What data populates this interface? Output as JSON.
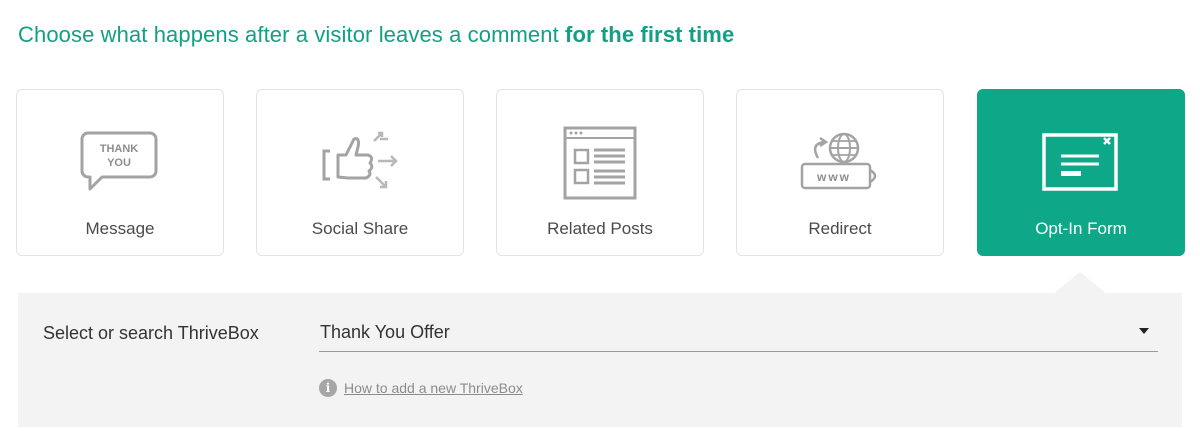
{
  "heading": {
    "prefix": "Choose what happens after a visitor leaves a comment",
    "emphasis": "for the first time"
  },
  "options": [
    {
      "label": "Message",
      "icon": "thank-you-bubble-icon",
      "icon_text_1": "THANK",
      "icon_text_2": "YOU",
      "active": false
    },
    {
      "label": "Social Share",
      "icon": "social-share-icon",
      "active": false
    },
    {
      "label": "Related Posts",
      "icon": "related-posts-icon",
      "active": false
    },
    {
      "label": "Redirect",
      "icon": "redirect-globe-icon",
      "icon_text": "www",
      "active": false
    },
    {
      "label": "Opt-In Form",
      "icon": "optin-form-icon",
      "active": true
    }
  ],
  "panel": {
    "select_label": "Select or search ThriveBox",
    "selected_value": "Thank You Offer",
    "help_link": "How to add a new ThriveBox",
    "help_icon": "i"
  },
  "colors": {
    "accent": "#0ea787",
    "heading": "#12a085",
    "icon_gray": "#9e9e9e",
    "panel_bg": "#f3f3f3"
  }
}
